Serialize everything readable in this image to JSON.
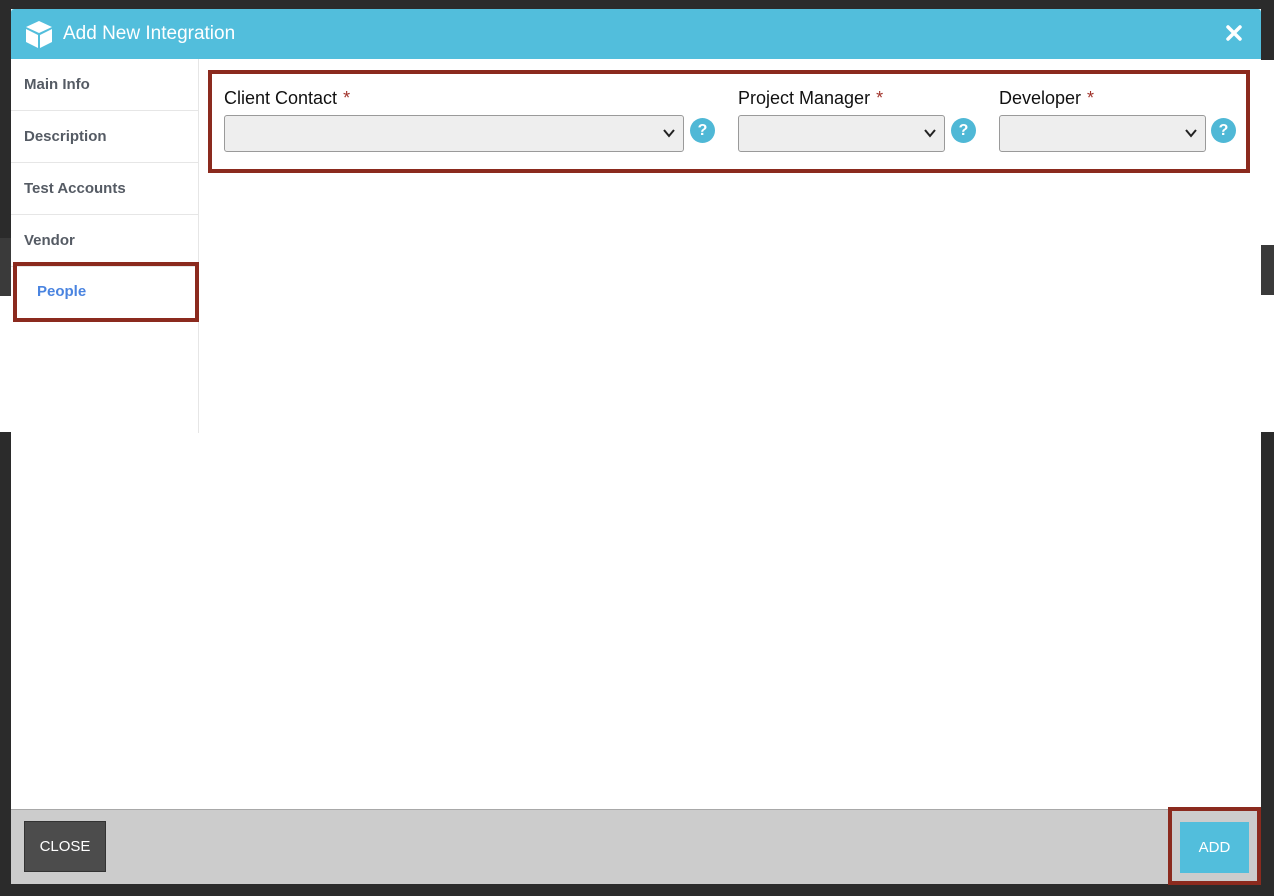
{
  "modal": {
    "title": "Add New Integration",
    "icon": "cube-icon",
    "close_icon": "close-icon"
  },
  "sidebar": {
    "items": [
      {
        "label": "Main Info"
      },
      {
        "label": "Description"
      },
      {
        "label": "Test Accounts"
      },
      {
        "label": "Vendor"
      },
      {
        "label": "People",
        "active": true
      }
    ]
  },
  "people": {
    "fields": [
      {
        "label": "Client Contact",
        "required_mark": "*",
        "value": ""
      },
      {
        "label": "Project Manager",
        "required_mark": "*",
        "value": ""
      },
      {
        "label": "Developer",
        "required_mark": "*",
        "value": ""
      }
    ],
    "help_glyph": "?"
  },
  "footer": {
    "close_label": "CLOSE",
    "add_label": "ADD"
  },
  "colors": {
    "header": "#52bedc",
    "active_nav": "#4a84e0",
    "highlight_border": "#8b2a1e",
    "required": "#a0322a"
  }
}
